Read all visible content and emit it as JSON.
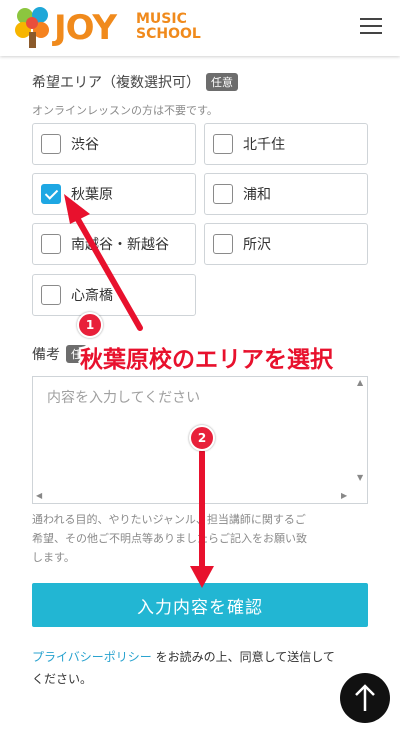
{
  "header": {
    "logo_word": "JOY",
    "logo_sub_line1": "MUSIC",
    "logo_sub_line2": "SCHOOL",
    "menu_icon": "hamburger-menu-icon"
  },
  "area_section": {
    "label": "希望エリア（複数選択可）",
    "badge": "任意",
    "hint": "オンラインレッスンの方は不要です。",
    "options": [
      {
        "label": "渋谷",
        "checked": false
      },
      {
        "label": "北千住",
        "checked": false
      },
      {
        "label": "秋葉原",
        "checked": true
      },
      {
        "label": "浦和",
        "checked": false
      },
      {
        "label": "南越谷・新越谷",
        "checked": false
      },
      {
        "label": "所沢",
        "checked": false
      },
      {
        "label": "心斎橋",
        "checked": false
      }
    ]
  },
  "notes_section": {
    "label": "備考",
    "badge": "任",
    "placeholder": "内容を入力してください",
    "helper_line1": "通われる目的、やりたいジャンル、担当講師に関するご",
    "helper_line2": "希望、その他ご不明点等ありましたらご記入をお願い致",
    "helper_line3": "します。"
  },
  "confirm_button": {
    "label": "入力内容を確認"
  },
  "privacy": {
    "link": "プライバシーポリシー",
    "text_after": " をお読みの上、同意して送信して",
    "text_line2": "ください。"
  },
  "back_to_top_icon": "arrow-up-icon",
  "annotation": {
    "callout": "秋葉原校のエリアを選択",
    "step1": "1",
    "step2": "2",
    "color": "#e8112d"
  },
  "colors": {
    "brand_orange": "#f08a1c",
    "accent_blue": "#22b6d3",
    "checkbox_blue": "#1ea7e3",
    "link_blue": "#2aa3cf"
  }
}
